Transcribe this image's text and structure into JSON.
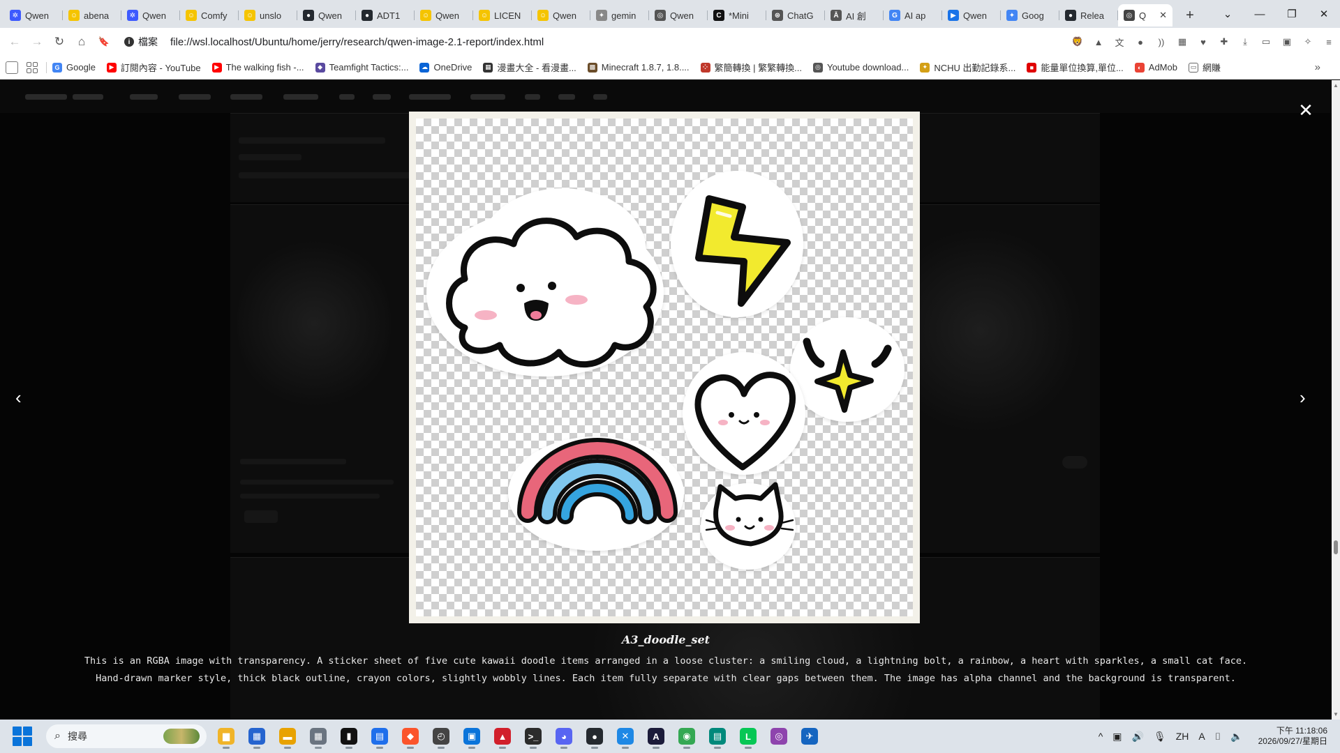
{
  "browser": {
    "tabs": [
      {
        "title": "Qwen",
        "color": "#3d5afe",
        "glyph": "✲"
      },
      {
        "title": "abena",
        "color": "#f5c400",
        "glyph": "☺"
      },
      {
        "title": "Qwen",
        "color": "#3d5afe",
        "glyph": "✲"
      },
      {
        "title": "Comfy",
        "color": "#f5c400",
        "glyph": "☺"
      },
      {
        "title": "unslo",
        "color": "#f5c400",
        "glyph": "☺"
      },
      {
        "title": "Qwen",
        "color": "#24292f",
        "glyph": "●"
      },
      {
        "title": "ADT1",
        "color": "#24292f",
        "glyph": "●"
      },
      {
        "title": "Qwen",
        "color": "#f5c400",
        "glyph": "☺"
      },
      {
        "title": "LICEN",
        "color": "#f5c400",
        "glyph": "☺"
      },
      {
        "title": "Qwen",
        "color": "#f5c400",
        "glyph": "☺"
      },
      {
        "title": "gemin",
        "color": "#888888",
        "glyph": "✦"
      },
      {
        "title": "Qwen",
        "color": "#555555",
        "glyph": "◎"
      },
      {
        "title": "*Mini",
        "color": "#111111",
        "glyph": "C"
      },
      {
        "title": "ChatG",
        "color": "#555555",
        "glyph": "⊛"
      },
      {
        "title": "AI 創",
        "color": "#555555",
        "glyph": "Ā"
      },
      {
        "title": "AI ap",
        "color": "#4285f4",
        "glyph": "G"
      },
      {
        "title": "Qwen",
        "color": "#1a73e8",
        "glyph": "▶"
      },
      {
        "title": "Goog",
        "color": "#4285f4",
        "glyph": "✦"
      },
      {
        "title": "Relea",
        "color": "#24292f",
        "glyph": "●"
      }
    ],
    "active_tab": {
      "title": "Q",
      "color": "#444444",
      "glyph": "◎"
    },
    "new_tab_label": "+",
    "window_controls": {
      "menu": "⌄",
      "minimize": "—",
      "restore": "❐",
      "close": "✕"
    },
    "nav": {
      "back": "←",
      "forward": "→",
      "reload": "↻",
      "home": "⌂",
      "bookmark": "🔖"
    },
    "security_label": "檔案",
    "security_icon": "i",
    "url": "file://wsl.localhost/Ubuntu/home/jerry/research/qwen-image-2.1-report/index.html",
    "extensions": [
      "🦁",
      "▲",
      "文",
      "●",
      "))",
      "▦",
      "♥",
      "✚",
      "⤓",
      "▭",
      "▣",
      "✧",
      "≡"
    ],
    "bookmarks": [
      {
        "label": "Google",
        "color": "#4285f4",
        "glyph": "G"
      },
      {
        "label": "訂閱內容 - YouTube",
        "color": "#ff0000",
        "glyph": "▶"
      },
      {
        "label": "The walking fish -...",
        "color": "#ff0000",
        "glyph": "▶"
      },
      {
        "label": "Teamfight Tactics:...",
        "color": "#5a4aa0",
        "glyph": "◆"
      },
      {
        "label": "OneDrive",
        "color": "#0a64d6",
        "glyph": "☁"
      },
      {
        "label": "漫畫大全 - 看漫畫...",
        "color": "#333333",
        "glyph": "▦"
      },
      {
        "label": "Minecraft 1.8.7, 1.8....",
        "color": "#6b4d2a",
        "glyph": "▩"
      },
      {
        "label": "繁簡轉換 | 繁繁轉換...",
        "color": "#c0392b",
        "glyph": "⁘"
      },
      {
        "label": "Youtube download...",
        "color": "#555555",
        "glyph": "◎"
      },
      {
        "label": "NCHU 出勤記錄系...",
        "color": "#d4a017",
        "glyph": "✦"
      },
      {
        "label": "能量單位換算,單位...",
        "color": "#e00000",
        "glyph": "■"
      },
      {
        "label": "AdMob",
        "color": "#ea4335",
        "glyph": "◐"
      },
      {
        "label": "網賺",
        "color": "#ffffff",
        "glyph": "▭"
      }
    ],
    "bookmarks_more": "»"
  },
  "lightbox": {
    "close_label": "✕",
    "prev_label": "‹",
    "next_label": "›",
    "title": "A3_doodle_set",
    "description_lines": [
      "This is an RGBA image with transparency. A sticker sheet of five cute kawaii doodle items arranged in a loose cluster: a smiling cloud, a lightning bolt, a rainbow, a heart with sparkles, a small cat face.",
      "Hand-drawn marker style, thick black outline, crayon colors, slightly wobbly lines. Each item fully separate with clear gaps between them. The image has alpha channel and the background is transparent."
    ],
    "stickers": [
      {
        "name": "cloud-sticker"
      },
      {
        "name": "lightning-bolt-sticker",
        "fill": "#f2ea2e"
      },
      {
        "name": "sparkles-sticker",
        "fill": "#f2ea2e"
      },
      {
        "name": "heart-sticker"
      },
      {
        "name": "rainbow-sticker",
        "colors": [
          "#e8667a",
          "#7fc7ee",
          "#34a4df"
        ]
      },
      {
        "name": "cat-face-sticker"
      }
    ]
  },
  "taskbar": {
    "search_placeholder": "搜尋",
    "apps": [
      {
        "name": "file-explorer-app",
        "color": "#f0b429",
        "glyph": "▆"
      },
      {
        "name": "store-app",
        "color": "#2564cf",
        "glyph": "▦"
      },
      {
        "name": "folder-app",
        "color": "#e8a200",
        "glyph": "▬"
      },
      {
        "name": "calculator-app",
        "color": "#6a7480",
        "glyph": "▦"
      },
      {
        "name": "terminal-app",
        "color": "#111111",
        "glyph": "▮"
      },
      {
        "name": "notepad-app",
        "color": "#1f6feb",
        "glyph": "▤"
      },
      {
        "name": "brave-browser-app",
        "color": "#fb542b",
        "glyph": "◆"
      },
      {
        "name": "clock-app",
        "color": "#444444",
        "glyph": "◴"
      },
      {
        "name": "photos-app",
        "color": "#0a74da",
        "glyph": "▣"
      },
      {
        "name": "red-app",
        "color": "#d11f2b",
        "glyph": "▲"
      },
      {
        "name": "cmd-app",
        "color": "#2b2b2b",
        "glyph": ">_"
      },
      {
        "name": "discord-app",
        "color": "#5865f2",
        "glyph": "◕"
      },
      {
        "name": "github-app",
        "color": "#24292f",
        "glyph": "●"
      },
      {
        "name": "vscode-app",
        "color": "#1e88e5",
        "glyph": "✕"
      },
      {
        "name": "vector-app",
        "color": "#1b1b3a",
        "glyph": "A"
      },
      {
        "name": "chrome-app",
        "color": "#34a853",
        "glyph": "◉"
      },
      {
        "name": "notes-app",
        "color": "#00897b",
        "glyph": "▤"
      },
      {
        "name": "line-app",
        "color": "#06c755",
        "glyph": "L"
      },
      {
        "name": "podcast-app",
        "color": "#8e44ad",
        "glyph": "◎"
      },
      {
        "name": "feedback-app",
        "color": "#1565c0",
        "glyph": "✈"
      }
    ],
    "tray_icons": [
      "^",
      "▣",
      "🔊",
      "🎙",
      "ZH",
      "A",
      "⌷",
      "🔈"
    ],
    "time": "下午 11:18:06",
    "date": "2026/09/27/星期日"
  }
}
